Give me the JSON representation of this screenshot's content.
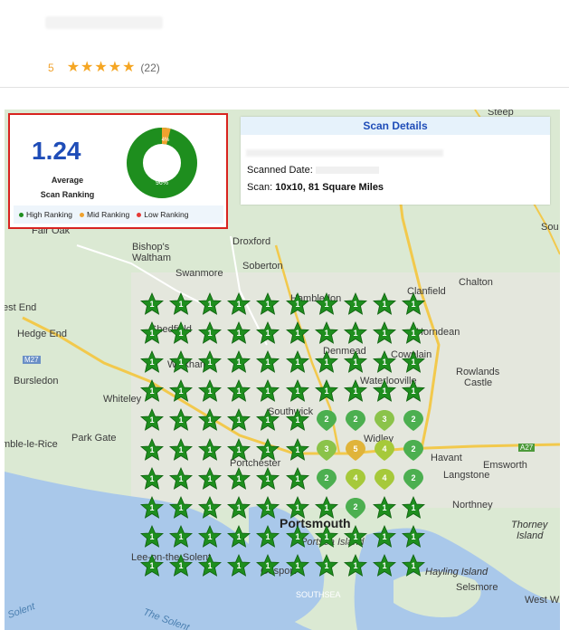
{
  "business": {
    "rating_value": "5",
    "stars": 5,
    "review_count": "(22)"
  },
  "summary": {
    "average_rank": "1.24",
    "average_label_line1": "Average",
    "average_label_line2": "Scan Ranking",
    "donut_high_pct": "96%",
    "donut_mid_pct": "4%",
    "donut_high_fraction": 0.96,
    "donut_mid_fraction": 0.04
  },
  "legend": {
    "high": "High Ranking",
    "mid": "Mid Ranking",
    "low": "Low Ranking"
  },
  "colors": {
    "high": "#1e8e1e",
    "mid": "#f0a22e",
    "low": "#e53935",
    "rank2": "#4caf50",
    "rank3": "#8bc34a",
    "rank4": "#a6c93a",
    "rank5": "#e0b43a"
  },
  "scan_details": {
    "title": "Scan Details",
    "scanned_date_label": "Scanned Date:",
    "scan_label": "Scan:",
    "scan_value": "10x10, 81 Square Miles"
  },
  "map_labels": [
    "Steep",
    "Sou",
    "Fair Oak",
    "Bishop's",
    "Waltham",
    "Droxford",
    "Swanmore",
    "Soberton",
    "Clanfield",
    "Chalton",
    "est End",
    "Hedge End",
    "Shedfield",
    "Hambledon",
    "Horndean",
    "M27",
    "Wickham",
    "Denmead",
    "Cowplain",
    "Bursledon",
    "Whiteley",
    "Waterlooville",
    "Rowlands",
    "Castle",
    "Southwick",
    "mble-le-Rice",
    "Park Gate",
    "Widley",
    "Havant",
    "A27",
    "Portchester",
    "Langstone",
    "Emsworth",
    "Northney",
    "Thorney",
    "Island",
    "Portsmouth",
    "Portsea Island",
    "Lee-on-the-Solent",
    "Gosport",
    "Hayling Island",
    "Selsmore",
    "West W",
    "Solent",
    "The Solent",
    "SOUTHSEA"
  ],
  "grid": {
    "size": 10,
    "ranks": [
      [
        1,
        1,
        1,
        1,
        1,
        1,
        1,
        1,
        1,
        1
      ],
      [
        1,
        1,
        1,
        1,
        1,
        1,
        1,
        1,
        1,
        1
      ],
      [
        1,
        1,
        1,
        1,
        1,
        1,
        1,
        1,
        1,
        1
      ],
      [
        1,
        1,
        1,
        1,
        1,
        1,
        1,
        1,
        1,
        1
      ],
      [
        1,
        1,
        1,
        1,
        1,
        1,
        2,
        2,
        3,
        2
      ],
      [
        1,
        1,
        1,
        1,
        1,
        1,
        3,
        5,
        4,
        2
      ],
      [
        1,
        1,
        1,
        1,
        1,
        1,
        2,
        4,
        4,
        2
      ],
      [
        1,
        1,
        1,
        1,
        1,
        1,
        1,
        2,
        1,
        1
      ],
      [
        1,
        1,
        1,
        1,
        1,
        1,
        1,
        1,
        1,
        1
      ],
      [
        1,
        1,
        1,
        1,
        1,
        1,
        1,
        1,
        1,
        1
      ]
    ]
  }
}
